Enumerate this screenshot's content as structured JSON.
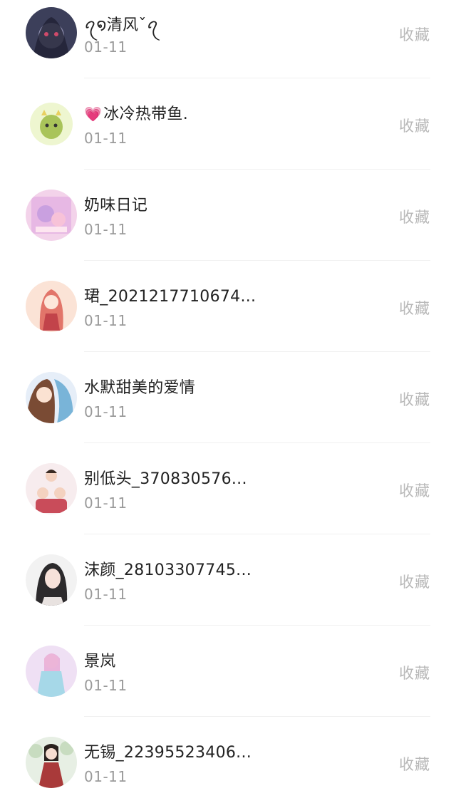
{
  "items": [
    {
      "name": "ꪖ໑清风ˇꪖ",
      "prefix_icon": "",
      "date": "01-11",
      "action": "收藏",
      "avatar_colors": [
        "#3c3f5a",
        "#8f8fb0"
      ]
    },
    {
      "name": "冰冷热带鱼.",
      "prefix_icon": "heart-icon",
      "date": "01-11",
      "action": "收藏",
      "avatar_colors": [
        "#eef6d0",
        "#a9c45a"
      ]
    },
    {
      "name": "奶味日记",
      "prefix_icon": "",
      "date": "01-11",
      "action": "收藏",
      "avatar_colors": [
        "#f3d3ea",
        "#c9a0e0"
      ]
    },
    {
      "name": "珺_2021217710674...",
      "prefix_icon": "",
      "date": "01-11",
      "action": "收藏",
      "avatar_colors": [
        "#fbe3d6",
        "#e2756a"
      ]
    },
    {
      "name": "水默甜美的爱情",
      "prefix_icon": "",
      "date": "01-11",
      "action": "收藏",
      "avatar_colors": [
        "#e6eef8",
        "#79b4d8"
      ]
    },
    {
      "name": "别低头_370830576...",
      "prefix_icon": "",
      "date": "01-11",
      "action": "收藏",
      "avatar_colors": [
        "#f7ecee",
        "#c94c5a"
      ]
    },
    {
      "name": "沫颜_28103307745...",
      "prefix_icon": "",
      "date": "01-11",
      "action": "收藏",
      "avatar_colors": [
        "#f2f2f2",
        "#2c2a2c"
      ]
    },
    {
      "name": "景岚",
      "prefix_icon": "",
      "date": "01-11",
      "action": "收藏",
      "avatar_colors": [
        "#efe0f4",
        "#a6d8e8"
      ]
    },
    {
      "name": "无锡_22395523406...",
      "prefix_icon": "",
      "date": "01-11",
      "action": "收藏",
      "avatar_colors": [
        "#e7efe4",
        "#a93a3a"
      ]
    }
  ]
}
